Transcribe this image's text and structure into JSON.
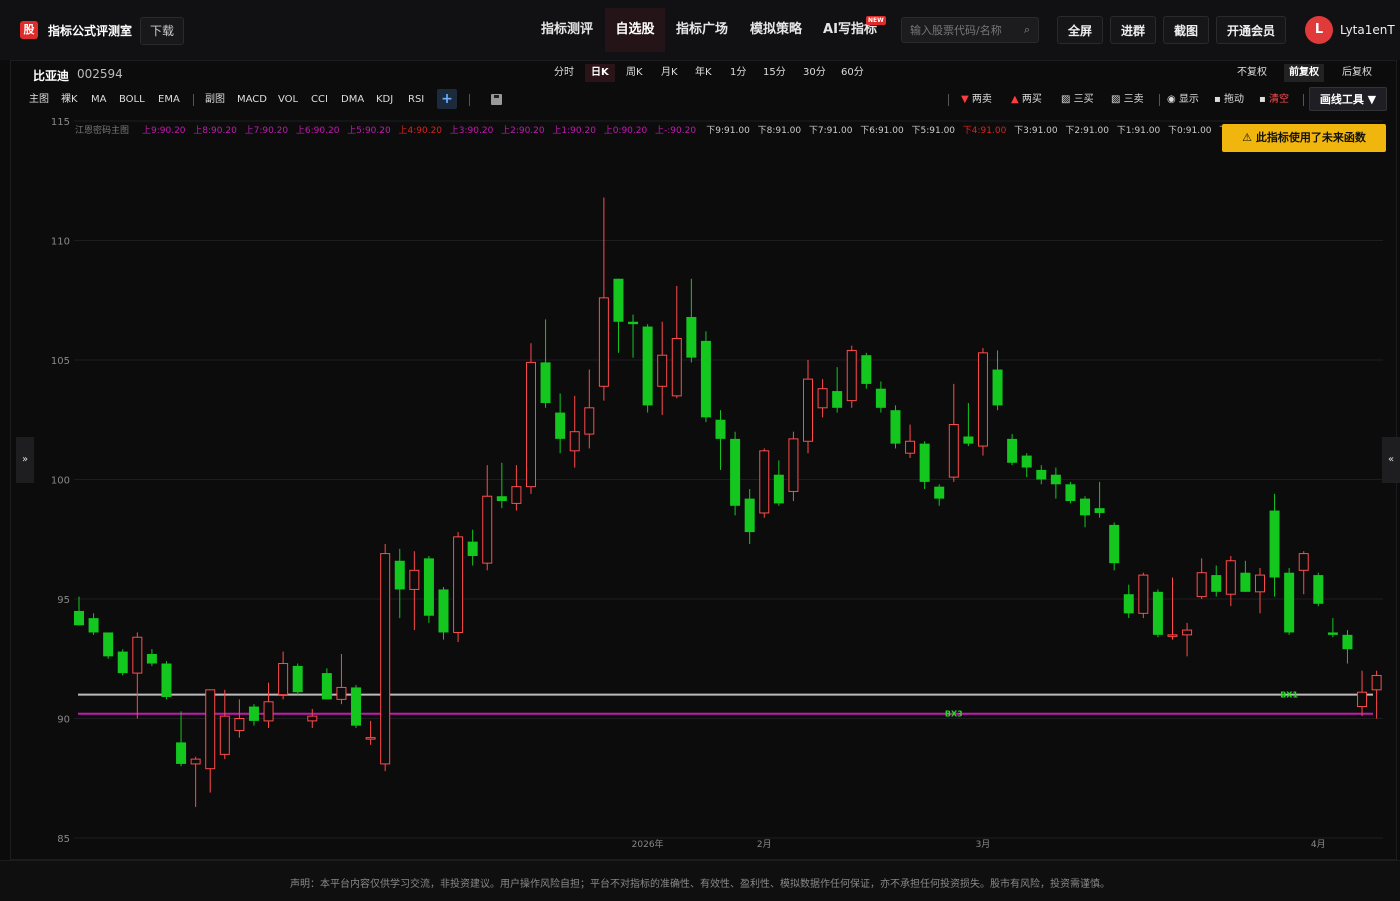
{
  "header": {
    "logo_char": "股",
    "brand": "指标公式评测室",
    "download": "下载",
    "nav": [
      "指标测评",
      "自选股",
      "指标广场",
      "模拟策略",
      "AI写指标"
    ],
    "nav_active": "自选股",
    "new_badge": "NEW",
    "search_placeholder": "输入股票代码/名称",
    "actions": [
      "全屏",
      "进群",
      "截图",
      "开通会员"
    ],
    "avatar_letter": "L",
    "username": "Lyta1enT"
  },
  "stock": {
    "name": "比亚迪",
    "code": "002594"
  },
  "periods": [
    "分时",
    "日K",
    "周K",
    "月K",
    "年K",
    "1分",
    "15分",
    "30分",
    "60分"
  ],
  "period_active": "日K",
  "adjust": [
    "不复权",
    "前复权",
    "后复权"
  ],
  "adjust_active": "前复权",
  "indicators_left": [
    "主图",
    "裸K",
    "MA",
    "BOLL",
    "EMA"
  ],
  "indicators_right": [
    "副图",
    "MACD",
    "VOL",
    "CCI",
    "DMA",
    "KDJ",
    "RSI"
  ],
  "add_label": "+",
  "draw_tools": [
    {
      "icon": "▼",
      "label": "两卖",
      "color": "#ff3b3b"
    },
    {
      "icon": "▲",
      "label": "两买",
      "color": "#ff3b3b"
    },
    {
      "icon": "▨",
      "label": "三买",
      "color": "#dddddd"
    },
    {
      "icon": "▨",
      "label": "三卖",
      "color": "#dddddd"
    },
    {
      "icon": "◉",
      "label": "显示",
      "color": "#dddddd"
    },
    {
      "icon": "▪",
      "label": "拖动",
      "color": "#dddddd"
    },
    {
      "icon": "▪",
      "label": "清空",
      "color": "#ff4d4f"
    }
  ],
  "draw_tool_menu": "画线工具 ▼",
  "warning": "⚠ 此指标使用了未来函数",
  "side_left": "»",
  "side_right": "«",
  "footer_text": "声明：本平台内容仅供学习交流，非投资建议。用户操作风险自担；平台不对指标的准确性、有效性、盈利性、模拟数据作任何保证，亦不承担任何投资损失。股市有风险，投资需谨慎。",
  "chart_data": {
    "type": "candlestick",
    "ylim": [
      85,
      115
    ],
    "yticks": [
      85,
      90,
      95,
      100,
      105,
      110,
      115
    ],
    "xticks": [
      {
        "index": 39,
        "label": "2026年"
      },
      {
        "index": 47,
        "label": "2月"
      },
      {
        "index": 62,
        "label": "3月"
      },
      {
        "index": 85,
        "label": "4月"
      }
    ],
    "legend_title": "江恩密码主图",
    "levels": [
      {
        "label": "上9:90.20",
        "color": "#c21ab0"
      },
      {
        "label": "上8:90.20",
        "color": "#c21ab0"
      },
      {
        "label": "上7:90.20",
        "color": "#c21ab0"
      },
      {
        "label": "上6:90.20",
        "color": "#c21ab0"
      },
      {
        "label": "上5:90.20",
        "color": "#c21ab0"
      },
      {
        "label": "上4:90.20",
        "color": "#e0201c"
      },
      {
        "label": "上3:90.20",
        "color": "#c21ab0"
      },
      {
        "label": "上2:90.20",
        "color": "#c21ab0"
      },
      {
        "label": "上1:90.20",
        "color": "#c21ab0"
      },
      {
        "label": "上0:90.20",
        "color": "#c21ab0"
      },
      {
        "label": "上-:90.20",
        "color": "#c21ab0"
      },
      {
        "label": "下9:91.00",
        "color": "#cccccc"
      },
      {
        "label": "下8:91.00",
        "color": "#cccccc"
      },
      {
        "label": "下7:91.00",
        "color": "#cccccc"
      },
      {
        "label": "下6:91.00",
        "color": "#cccccc"
      },
      {
        "label": "下5:91.00",
        "color": "#cccccc"
      },
      {
        "label": "下4:91.00",
        "color": "#e0201c"
      },
      {
        "label": "下3:91.00",
        "color": "#cccccc"
      },
      {
        "label": "下2:91.00",
        "color": "#cccccc"
      },
      {
        "label": "下1:91.00",
        "color": "#cccccc"
      },
      {
        "label": "下0:91.00",
        "color": "#cccccc"
      },
      {
        "label": "下",
        "color": "#cccccc"
      }
    ],
    "hlines": [
      {
        "value": 91.0,
        "color": "#bbbbbb"
      },
      {
        "value": 90.2,
        "color": "#c21ab0"
      }
    ],
    "markers": [
      {
        "index": 60,
        "value": 90.2,
        "label": "BX3",
        "color": "#22dd22"
      },
      {
        "index": 83,
        "value": 91.0,
        "label": "BX1",
        "color": "#22dd22"
      }
    ],
    "up_color": "#ff4b4b",
    "down_color": "#14c71f",
    "candles": [
      {
        "o": 94.5,
        "h": 95.1,
        "l": 93.9,
        "c": 93.9
      },
      {
        "o": 94.2,
        "h": 94.4,
        "l": 93.5,
        "c": 93.6
      },
      {
        "o": 93.6,
        "h": 93.6,
        "l": 92.5,
        "c": 92.6
      },
      {
        "o": 92.8,
        "h": 92.9,
        "l": 91.8,
        "c": 91.9
      },
      {
        "o": 91.9,
        "h": 93.6,
        "l": 90.0,
        "c": 93.4
      },
      {
        "o": 92.7,
        "h": 92.9,
        "l": 92.2,
        "c": 92.3
      },
      {
        "o": 92.3,
        "h": 92.4,
        "l": 90.8,
        "c": 90.9
      },
      {
        "o": 89.0,
        "h": 90.3,
        "l": 88.0,
        "c": 88.1
      },
      {
        "o": 88.1,
        "h": 88.4,
        "l": 86.3,
        "c": 88.3
      },
      {
        "o": 87.9,
        "h": 91.2,
        "l": 86.9,
        "c": 91.2
      },
      {
        "o": 88.5,
        "h": 91.2,
        "l": 88.3,
        "c": 90.1
      },
      {
        "o": 89.5,
        "h": 90.8,
        "l": 89.2,
        "c": 90.0
      },
      {
        "o": 90.5,
        "h": 90.6,
        "l": 89.7,
        "c": 89.9
      },
      {
        "o": 89.9,
        "h": 91.5,
        "l": 89.6,
        "c": 90.7
      },
      {
        "o": 91.0,
        "h": 92.8,
        "l": 90.8,
        "c": 92.3
      },
      {
        "o": 92.2,
        "h": 92.3,
        "l": 91.0,
        "c": 91.1
      },
      {
        "o": 89.9,
        "h": 90.4,
        "l": 89.6,
        "c": 90.1
      },
      {
        "o": 91.9,
        "h": 92.1,
        "l": 90.8,
        "c": 90.8
      },
      {
        "o": 90.8,
        "h": 92.7,
        "l": 90.6,
        "c": 91.3
      },
      {
        "o": 91.3,
        "h": 91.4,
        "l": 89.6,
        "c": 89.7
      },
      {
        "o": 89.2,
        "h": 89.9,
        "l": 88.9,
        "c": 89.2
      },
      {
        "o": 88.1,
        "h": 97.3,
        "l": 87.8,
        "c": 96.9
      },
      {
        "o": 96.6,
        "h": 97.1,
        "l": 94.2,
        "c": 95.4
      },
      {
        "o": 95.4,
        "h": 97.0,
        "l": 93.7,
        "c": 96.2
      },
      {
        "o": 96.7,
        "h": 96.8,
        "l": 94.0,
        "c": 94.3
      },
      {
        "o": 95.4,
        "h": 95.5,
        "l": 93.3,
        "c": 93.6
      },
      {
        "o": 93.6,
        "h": 97.8,
        "l": 93.2,
        "c": 97.6
      },
      {
        "o": 97.4,
        "h": 97.9,
        "l": 96.4,
        "c": 96.8
      },
      {
        "o": 96.5,
        "h": 100.6,
        "l": 96.2,
        "c": 99.3
      },
      {
        "o": 99.3,
        "h": 100.7,
        "l": 98.8,
        "c": 99.1
      },
      {
        "o": 99.0,
        "h": 100.6,
        "l": 98.7,
        "c": 99.7
      },
      {
        "o": 99.7,
        "h": 105.7,
        "l": 99.4,
        "c": 104.9
      },
      {
        "o": 104.9,
        "h": 106.7,
        "l": 103.0,
        "c": 103.2
      },
      {
        "o": 102.8,
        "h": 103.6,
        "l": 101.1,
        "c": 101.7
      },
      {
        "o": 101.2,
        "h": 103.5,
        "l": 100.5,
        "c": 102.0
      },
      {
        "o": 101.9,
        "h": 104.6,
        "l": 101.3,
        "c": 103.0
      },
      {
        "o": 103.9,
        "h": 111.8,
        "l": 103.3,
        "c": 107.6
      },
      {
        "o": 108.4,
        "h": 108.4,
        "l": 105.3,
        "c": 106.6
      },
      {
        "o": 106.6,
        "h": 106.9,
        "l": 105.1,
        "c": 106.5
      },
      {
        "o": 106.4,
        "h": 106.5,
        "l": 102.8,
        "c": 103.1
      },
      {
        "o": 103.9,
        "h": 106.6,
        "l": 102.7,
        "c": 105.2
      },
      {
        "o": 103.5,
        "h": 108.1,
        "l": 103.4,
        "c": 105.9
      },
      {
        "o": 106.8,
        "h": 108.4,
        "l": 104.9,
        "c": 105.1
      },
      {
        "o": 105.8,
        "h": 106.2,
        "l": 102.4,
        "c": 102.6
      },
      {
        "o": 102.5,
        "h": 102.9,
        "l": 100.4,
        "c": 101.7
      },
      {
        "o": 101.7,
        "h": 102.0,
        "l": 98.5,
        "c": 98.9
      },
      {
        "o": 99.2,
        "h": 99.6,
        "l": 97.3,
        "c": 97.8
      },
      {
        "o": 98.6,
        "h": 101.3,
        "l": 98.4,
        "c": 101.2
      },
      {
        "o": 100.2,
        "h": 100.8,
        "l": 98.9,
        "c": 99.0
      },
      {
        "o": 99.5,
        "h": 102.0,
        "l": 99.1,
        "c": 101.7
      },
      {
        "o": 101.6,
        "h": 105.0,
        "l": 101.1,
        "c": 104.2
      },
      {
        "o": 103.0,
        "h": 104.2,
        "l": 102.6,
        "c": 103.8
      },
      {
        "o": 103.7,
        "h": 104.7,
        "l": 102.8,
        "c": 103.0
      },
      {
        "o": 103.3,
        "h": 105.6,
        "l": 103.0,
        "c": 105.4
      },
      {
        "o": 105.2,
        "h": 105.3,
        "l": 103.8,
        "c": 104.0
      },
      {
        "o": 103.8,
        "h": 104.1,
        "l": 102.8,
        "c": 103.0
      },
      {
        "o": 102.9,
        "h": 103.1,
        "l": 101.3,
        "c": 101.5
      },
      {
        "o": 101.1,
        "h": 102.3,
        "l": 100.9,
        "c": 101.6
      },
      {
        "o": 101.5,
        "h": 101.6,
        "l": 99.6,
        "c": 99.9
      },
      {
        "o": 99.7,
        "h": 99.8,
        "l": 98.9,
        "c": 99.2
      },
      {
        "o": 100.1,
        "h": 104.0,
        "l": 99.9,
        "c": 102.3
      },
      {
        "o": 101.8,
        "h": 103.2,
        "l": 101.4,
        "c": 101.5
      },
      {
        "o": 101.4,
        "h": 105.5,
        "l": 101.0,
        "c": 105.3
      },
      {
        "o": 104.6,
        "h": 105.4,
        "l": 102.9,
        "c": 103.1
      },
      {
        "o": 101.7,
        "h": 101.9,
        "l": 100.6,
        "c": 100.7
      },
      {
        "o": 101.0,
        "h": 101.1,
        "l": 100.1,
        "c": 100.5
      },
      {
        "o": 100.4,
        "h": 100.6,
        "l": 99.8,
        "c": 100.0
      },
      {
        "o": 100.2,
        "h": 100.5,
        "l": 99.2,
        "c": 99.8
      },
      {
        "o": 99.8,
        "h": 99.9,
        "l": 99.0,
        "c": 99.1
      },
      {
        "o": 99.2,
        "h": 99.3,
        "l": 98.0,
        "c": 98.5
      },
      {
        "o": 98.8,
        "h": 99.9,
        "l": 98.4,
        "c": 98.6
      },
      {
        "o": 98.1,
        "h": 98.2,
        "l": 96.2,
        "c": 96.5
      },
      {
        "o": 95.2,
        "h": 95.6,
        "l": 94.2,
        "c": 94.4
      },
      {
        "o": 94.4,
        "h": 96.1,
        "l": 94.2,
        "c": 96.0
      },
      {
        "o": 95.3,
        "h": 95.4,
        "l": 93.4,
        "c": 93.5
      },
      {
        "o": 93.5,
        "h": 95.9,
        "l": 93.3,
        "c": 93.5
      },
      {
        "o": 93.5,
        "h": 94.0,
        "l": 92.6,
        "c": 93.7
      },
      {
        "o": 95.1,
        "h": 96.7,
        "l": 95.0,
        "c": 96.1
      },
      {
        "o": 96.0,
        "h": 96.4,
        "l": 95.1,
        "c": 95.3
      },
      {
        "o": 95.2,
        "h": 96.8,
        "l": 94.7,
        "c": 96.6
      },
      {
        "o": 96.1,
        "h": 96.6,
        "l": 95.3,
        "c": 95.3
      },
      {
        "o": 95.3,
        "h": 96.3,
        "l": 94.4,
        "c": 96.0
      },
      {
        "o": 98.7,
        "h": 99.4,
        "l": 95.1,
        "c": 95.9
      },
      {
        "o": 96.1,
        "h": 96.3,
        "l": 93.5,
        "c": 93.6
      },
      {
        "o": 96.2,
        "h": 97.0,
        "l": 95.2,
        "c": 96.9
      },
      {
        "o": 96.0,
        "h": 96.1,
        "l": 94.7,
        "c": 94.8
      },
      {
        "o": 93.6,
        "h": 94.2,
        "l": 93.4,
        "c": 93.5
      },
      {
        "o": 93.5,
        "h": 93.7,
        "l": 92.3,
        "c": 92.9
      },
      {
        "o": 90.5,
        "h": 92.0,
        "l": 90.1,
        "c": 91.1
      },
      {
        "o": 91.2,
        "h": 92.0,
        "l": 90.0,
        "c": 91.8
      },
      {
        "o": 91.0,
        "h": 91.1,
        "l": 90.3,
        "c": 90.4
      }
    ]
  }
}
